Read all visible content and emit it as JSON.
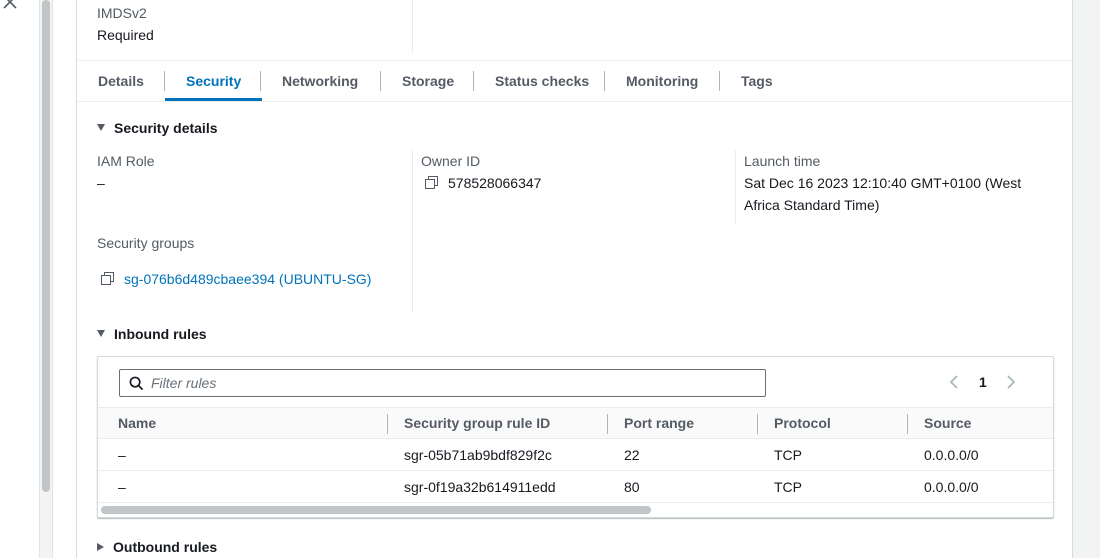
{
  "window": {
    "close_icon": "close-icon"
  },
  "instance": {
    "imds_label": "IMDSv2",
    "imds_value": "Required"
  },
  "tabs": [
    {
      "label": "Details"
    },
    {
      "label": "Security"
    },
    {
      "label": "Networking"
    },
    {
      "label": "Storage"
    },
    {
      "label": "Status checks"
    },
    {
      "label": "Monitoring"
    },
    {
      "label": "Tags"
    }
  ],
  "active_tab": "Security",
  "security_details": {
    "title": "Security details",
    "iam_role_label": "IAM Role",
    "iam_role_value": "–",
    "owner_id_label": "Owner ID",
    "owner_id_value": "578528066347",
    "launch_time_label": "Launch time",
    "launch_time_line1": "Sat Dec 16 2023 12:10:40 GMT+0100 (West",
    "launch_time_line2": "Africa Standard Time)",
    "security_groups_label": "Security groups",
    "security_group_link": "sg-076b6d489cbaee394 (UBUNTU-SG)"
  },
  "inbound_rules": {
    "title": "Inbound rules",
    "filter_placeholder": "Filter rules",
    "page": "1",
    "columns": [
      "Name",
      "Security group rule ID",
      "Port range",
      "Protocol",
      "Source"
    ],
    "rows": [
      {
        "name": "–",
        "rule_id": "sgr-05b71ab9bdf829f2c",
        "port_range": "22",
        "protocol": "TCP",
        "source": "0.0.0.0/0"
      },
      {
        "name": "–",
        "rule_id": "sgr-0f19a32b614911edd",
        "port_range": "80",
        "protocol": "TCP",
        "source": "0.0.0.0/0"
      }
    ]
  },
  "outbound_rules": {
    "title": "Outbound rules"
  },
  "colors": {
    "accent": "#0073bb",
    "text": "#16191f",
    "muted": "#545b64"
  }
}
